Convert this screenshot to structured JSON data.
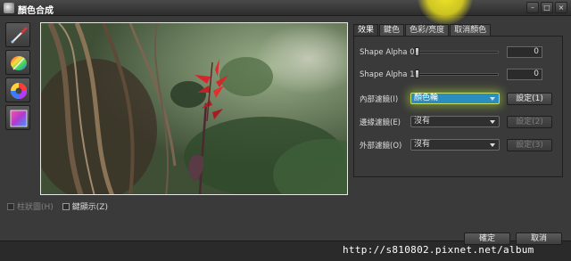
{
  "window": {
    "title": "顏色合成"
  },
  "preview": {
    "description_icon": "flower-photo"
  },
  "toolbar": {
    "tools": [
      {
        "name": "eyedropper-icon"
      },
      {
        "name": "color-palette-icon"
      },
      {
        "name": "color-wheel-icon"
      },
      {
        "name": "gradient-square-icon"
      }
    ]
  },
  "options": {
    "histogram": "柱狀圖(H)",
    "keyer_display": "鍵顯示(Z)"
  },
  "tabs": [
    {
      "label": "效果",
      "active": true
    },
    {
      "label": "鍵色",
      "active": false
    },
    {
      "label": "色彩/亮度",
      "active": false
    },
    {
      "label": "取消顏色",
      "active": false
    }
  ],
  "effect": {
    "shape_alpha_0": {
      "label": "Shape Alpha 0",
      "value": "0"
    },
    "shape_alpha_1": {
      "label": "Shape Alpha 1",
      "value": "0"
    },
    "inner_filter": {
      "label": "內部濾鏡(I)",
      "value": "顏色輪",
      "button": "設定(1)"
    },
    "edge_filter": {
      "label": "邊緣濾鏡(E)",
      "value": "沒有",
      "button": "設定(2)"
    },
    "outer_filter": {
      "label": "外部濾鏡(O)",
      "value": "沒有",
      "button": "設定(3)"
    }
  },
  "footer": {
    "ok": "確定",
    "cancel": "取消",
    "watermark": "http://s810802.pixnet.net/album"
  },
  "colors": {
    "accent_combo": "#2a8fbf",
    "highlight_glow": "#c6dc6a",
    "title_glow": "#f0e828"
  }
}
